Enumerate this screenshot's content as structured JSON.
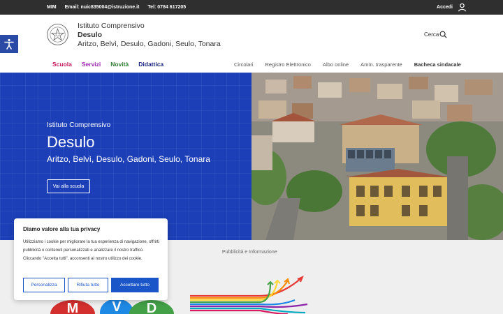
{
  "topbar": {
    "links": [
      "MIM",
      "Email: nuic835004@istruzione.it",
      "Tel: 0784 617205"
    ],
    "login": "Accedi"
  },
  "header": {
    "line1": "Istituto Comprensivo",
    "line2": "Desulo",
    "line3": "Aritzo, Belvì, Desulo, Gadoni, Seulo, Tonara",
    "search_label": "Cerca"
  },
  "nav": {
    "left": [
      {
        "label": "Scuola",
        "color": "#c2185b"
      },
      {
        "label": "Servizi",
        "color": "#9c27b0"
      },
      {
        "label": "Novità",
        "color": "#2e7d32"
      },
      {
        "label": "Didattica",
        "color": "#1a237e"
      }
    ],
    "right": [
      "Circolari",
      "Registro Elettronico",
      "Albo online",
      "Amm. trasparente",
      "Bacheca sindacale"
    ]
  },
  "hero": {
    "subtitle": "Istituto Comprensivo",
    "title": "Desulo",
    "towns": "Aritzo, Belvì, Desulo, Gadoni, Seulo, Tonara",
    "button": "Vai alla scuola"
  },
  "section": {
    "label": "Pubblicità e Informazione"
  },
  "mvd": [
    "M",
    "V",
    "D"
  ],
  "cookie": {
    "title": "Diamo valore alla tua privacy",
    "text": "Utilizziamo i cookie per migliorare la tua esperienza di navigazione, offrirti pubblicità o contenuti personalizzati e analizzare il nostro traffico. Cliccando \"Accetta tutti\", acconsenti al nostro utilizzo dei cookie.",
    "btn_customize": "Personalizza",
    "btn_reject": "Rifiuta tutto",
    "btn_accept": "Accettare tutto"
  }
}
